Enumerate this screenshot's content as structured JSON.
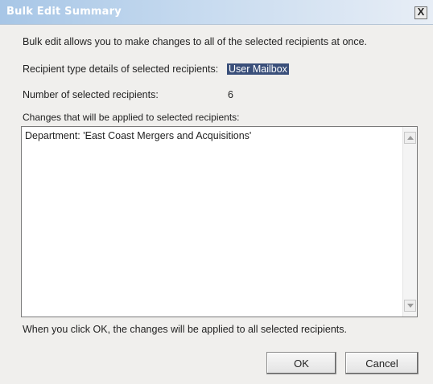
{
  "window": {
    "title": "Bulk Edit Summary",
    "close_label": "X"
  },
  "info": {
    "description": "Bulk edit allows you to make changes to all of the selected recipients at once.",
    "recipient_type_label": "Recipient type details of selected recipients:",
    "recipient_type_value": "User Mailbox",
    "count_label": "Number of selected recipients:",
    "count_value": "6",
    "changes_label": "Changes that will be applied to selected recipients:"
  },
  "changes": {
    "lines": [
      "Department: 'East Coast Mergers and Acquisitions'"
    ]
  },
  "footer": {
    "note": "When you click OK, the changes will be applied to all selected recipients.",
    "ok_label": "OK",
    "cancel_label": "Cancel"
  },
  "colors": {
    "title_bar_start": "#a7c6e6",
    "selection_highlight": "#3a4f7a",
    "dialog_background": "#f0efed"
  }
}
